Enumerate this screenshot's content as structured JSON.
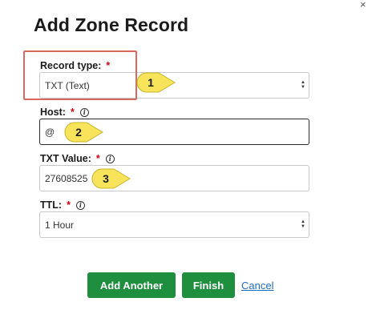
{
  "dialog": {
    "title": "Add Zone Record",
    "close_glyph": "×"
  },
  "fields": {
    "record_type": {
      "label": "Record type:",
      "required_mark": "*",
      "value": "TXT (Text)"
    },
    "host": {
      "label": "Host:",
      "required_mark": "*",
      "info_glyph": "i",
      "value": "@"
    },
    "txt_value": {
      "label": "TXT Value:",
      "required_mark": "*",
      "info_glyph": "i",
      "value": "27608525"
    },
    "ttl": {
      "label": "TTL:",
      "required_mark": "*",
      "info_glyph": "i",
      "value": "1 Hour"
    }
  },
  "callouts": {
    "one": "1",
    "two": "2",
    "three": "3",
    "color": "#f7e45a"
  },
  "buttons": {
    "add_another": "Add Another",
    "finish": "Finish",
    "cancel": "Cancel"
  },
  "colors": {
    "primary_button": "#1e8f3e",
    "required": "#d0021b",
    "link": "#1f6fc1",
    "highlight_border": "#d9695e"
  }
}
